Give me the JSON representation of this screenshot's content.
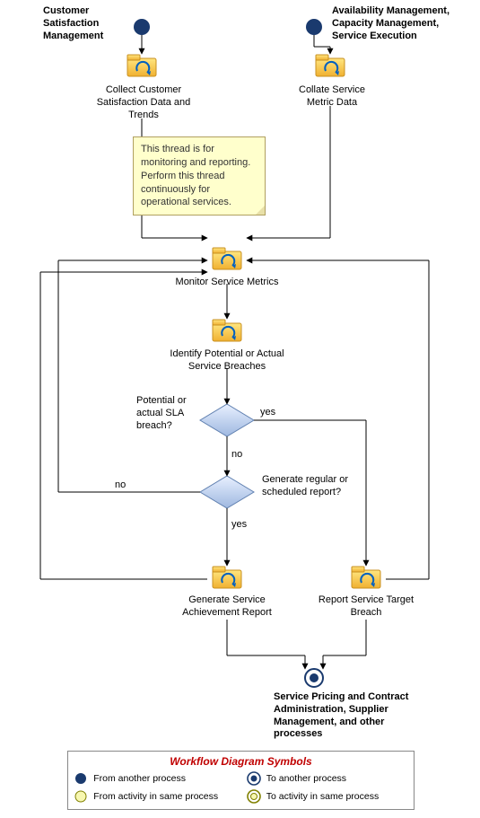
{
  "headers": {
    "left": "Customer Satisfaction Management",
    "right": "Availability Management, Capacity Management, Service Execution"
  },
  "activities": {
    "collect": "Collect Customer Satisfaction Data and Trends",
    "collate": "Collate Service Metric Data",
    "monitor": "Monitor Service Metrics",
    "identify": "Identify Potential or Actual Service Breaches",
    "genReport": "Generate Service Achievement Report",
    "reportBreach": "Report Service Target Breach"
  },
  "decisions": {
    "d1": {
      "question": "Potential or actual SLA breach?",
      "yes": "yes",
      "no": "no"
    },
    "d2": {
      "question": "Generate regular or scheduled report?",
      "yes": "yes",
      "no": "no"
    }
  },
  "note": "This thread is for monitoring and reporting. Perform this thread continuously for operational services.",
  "endLabel": "Service Pricing and Contract Administration, Supplier Management, and other processes",
  "legend": {
    "title": "Workflow Diagram Symbols",
    "items": {
      "fromAnother": "From another process",
      "toAnother": "To another process",
      "fromActivity": "From activity in same process",
      "toActivity": "To activity in same process"
    }
  },
  "chart_data": {
    "type": "flowchart",
    "startEvents": [
      {
        "id": "start_left",
        "source": "Customer Satisfaction Management",
        "kind": "from_another_process"
      },
      {
        "id": "start_right",
        "source": "Availability Management, Capacity Management, Service Execution",
        "kind": "from_another_process"
      }
    ],
    "activities": [
      {
        "id": "collect",
        "label": "Collect Customer Satisfaction Data and Trends"
      },
      {
        "id": "collate",
        "label": "Collate Service Metric Data"
      },
      {
        "id": "monitor",
        "label": "Monitor Service Metrics"
      },
      {
        "id": "identify",
        "label": "Identify Potential or Actual Service Breaches"
      },
      {
        "id": "genReport",
        "label": "Generate Service Achievement Report"
      },
      {
        "id": "reportBreach",
        "label": "Report Service Target Breach"
      }
    ],
    "decisions": [
      {
        "id": "d1",
        "question": "Potential or actual SLA breach?"
      },
      {
        "id": "d2",
        "question": "Generate regular or scheduled report?"
      }
    ],
    "endEvents": [
      {
        "id": "end",
        "target": "Service Pricing and Contract Administration, Supplier Management, and other processes",
        "kind": "to_another_process"
      }
    ],
    "annotations": [
      {
        "id": "note",
        "text": "This thread is for monitoring and reporting. Perform this thread continuously for operational services.",
        "attachedTo": "monitor"
      }
    ],
    "edges": [
      {
        "from": "start_left",
        "to": "collect"
      },
      {
        "from": "start_right",
        "to": "collate"
      },
      {
        "from": "collect",
        "to": "monitor"
      },
      {
        "from": "collate",
        "to": "monitor"
      },
      {
        "from": "monitor",
        "to": "identify"
      },
      {
        "from": "identify",
        "to": "d1"
      },
      {
        "from": "d1",
        "to": "reportBreach",
        "label": "yes"
      },
      {
        "from": "d1",
        "to": "d2",
        "label": "no"
      },
      {
        "from": "d2",
        "to": "genReport",
        "label": "yes"
      },
      {
        "from": "d2",
        "to": "monitor",
        "label": "no"
      },
      {
        "from": "genReport",
        "to": "end"
      },
      {
        "from": "reportBreach",
        "to": "end"
      },
      {
        "from": "genReport",
        "to": "monitor",
        "kind": "loop_back"
      },
      {
        "from": "reportBreach",
        "to": "monitor",
        "kind": "loop_back"
      }
    ]
  }
}
